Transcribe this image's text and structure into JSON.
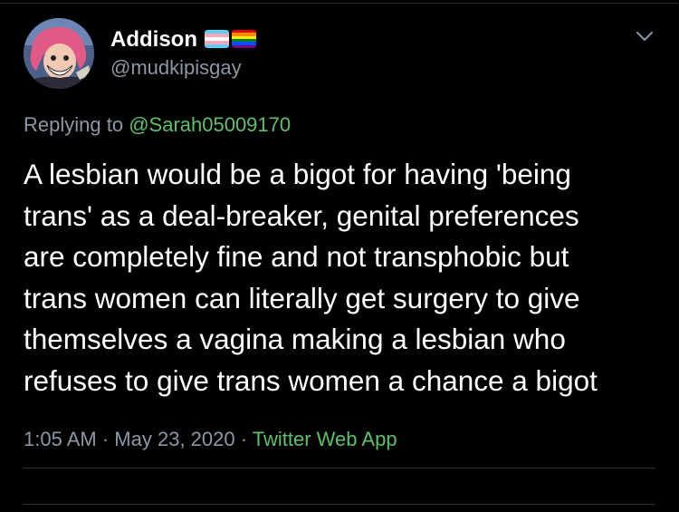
{
  "tweet": {
    "display_name": "Addison",
    "handle": "@mudkipisgay",
    "reply_prefix": "Replying to",
    "reply_mention": "@Sarah05009170",
    "text": "A lesbian would be a bigot for having 'being\ntrans' as a deal-breaker, genital preferences\nare completely fine and not transphobic but\ntrans women can literally get surgery to give\nthemselves a vagina making a lesbian who\nrefuses to give trans women a chance a bigot",
    "time": "1:05 AM",
    "separator": "·",
    "date": "May 23, 2020",
    "source": "Twitter Web App"
  },
  "icons": {
    "avatar": "avatar-image",
    "flags": [
      "transgender-flag-icon",
      "rainbow-flag-icon"
    ],
    "menu": "chevron-down-icon"
  },
  "colors": {
    "background": "#000000",
    "text": "#ffffff",
    "secondary_text": "#8b98a5",
    "link": "#5fc06a",
    "divider": "#2f3336"
  }
}
